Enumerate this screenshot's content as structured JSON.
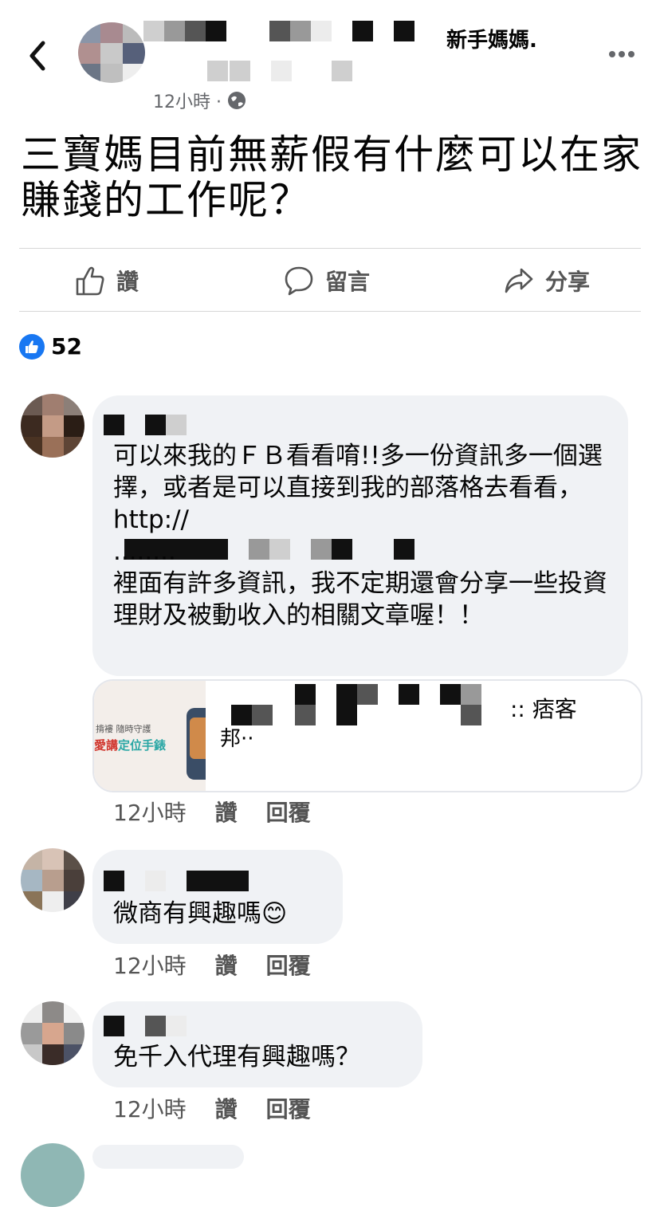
{
  "header": {
    "group_name": "新手媽媽.",
    "timestamp": "12小時 ·"
  },
  "post": {
    "text": "三寶媽目前無薪假有什麼可以在家賺錢的工作呢？"
  },
  "actions": {
    "like": "讚",
    "comment": "留言",
    "share": "分享"
  },
  "reactions": {
    "count": "52"
  },
  "comments": [
    {
      "text": "可以來我的ＦＢ看看唷!!多一份資訊多一個選擇，或者是可以直接到我的部落格去看看，http://",
      "text_after_link": "........\n裡面有許多資訊，我不定期還會分享一些投資理財及被動收入的相關文章喔！！",
      "link_preview": {
        "title_suffix": ":: 痞客",
        "title_line2": "邦··",
        "image_text_small": "揹褸  隨時守護",
        "image_text_red": "愛講",
        "image_text_teal": "定位手錶"
      },
      "time": "12小時",
      "like": "讚",
      "reply": "回覆"
    },
    {
      "text": "微商有興趣嗎😊",
      "time": "12小時",
      "like": "讚",
      "reply": "回覆"
    },
    {
      "text": "免千入代理有興趣嗎？",
      "time": "12小時",
      "like": "讚",
      "reply": "回覆"
    }
  ]
}
